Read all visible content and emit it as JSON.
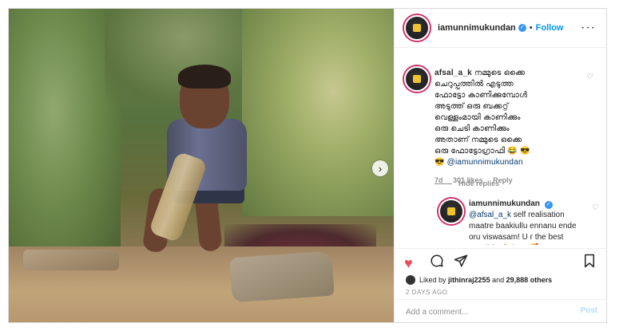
{
  "post": {
    "username": "iamunnimukundan",
    "follow_label": "Follow",
    "more_icon": "more-dots-icon",
    "verified_icon": "verified-badge-icon"
  },
  "comments": [
    {
      "username": "afsal_a_k",
      "lines": [
        "നമ്മുടെ ഒക്കെ",
        "ചെറുപ്പത്തിൽ എടുത്ത",
        "ഫോട്ടോ കാണിക്കുമ്പോൾ",
        "അടുത്ത് ഒരു ബക്കറ്റ്",
        "വെള്ളംമായി കാണിക്കും",
        "ഒരു ചെടി കാണിക്കും",
        "അതാണ് നമ്മുടെ ഒക്കെ",
        "ഒരു ഫോട്ടോഗ്രാഫി 😂 😎"
      ],
      "emoji_line": "😎",
      "mention": "@iamunnimukundan",
      "time": "7d",
      "likes": "301 likes",
      "reply": "Reply",
      "hide_replies": "Hide replies"
    },
    {
      "username": "iamunnimukundan",
      "mention": "@afsal_a_k",
      "text": "self realisation maatre baakiullu ennanu ende oru viswasam! U r the best possible 🙏 bro! 🥰"
    }
  ],
  "actions": {
    "like_icon": "heart-filled-icon",
    "comment_icon": "comment-icon",
    "share_icon": "share-icon",
    "save_icon": "bookmark-icon"
  },
  "likes_line": {
    "prefix": "Liked by",
    "user": "jithinraj2255",
    "middle": "and",
    "count": "29,888 others"
  },
  "timestamp": "2 DAYS AGO",
  "add_comment": {
    "placeholder": "Add a comment...",
    "post_label": "Post"
  },
  "colors": {
    "link": "#0095f6",
    "like": "#ed4956",
    "muted": "#8e8e8e"
  }
}
